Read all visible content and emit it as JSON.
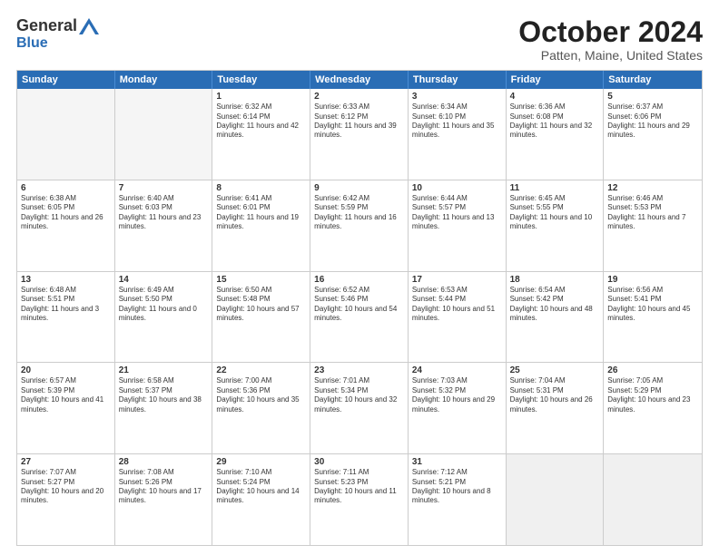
{
  "logo": {
    "general": "General",
    "blue": "Blue"
  },
  "title": "October 2024",
  "subtitle": "Patten, Maine, United States",
  "days": [
    "Sunday",
    "Monday",
    "Tuesday",
    "Wednesday",
    "Thursday",
    "Friday",
    "Saturday"
  ],
  "rows": [
    [
      {
        "day": "",
        "empty": true
      },
      {
        "day": "",
        "empty": true
      },
      {
        "day": "1",
        "sunrise": "Sunrise: 6:32 AM",
        "sunset": "Sunset: 6:14 PM",
        "daylight": "Daylight: 11 hours and 42 minutes."
      },
      {
        "day": "2",
        "sunrise": "Sunrise: 6:33 AM",
        "sunset": "Sunset: 6:12 PM",
        "daylight": "Daylight: 11 hours and 39 minutes."
      },
      {
        "day": "3",
        "sunrise": "Sunrise: 6:34 AM",
        "sunset": "Sunset: 6:10 PM",
        "daylight": "Daylight: 11 hours and 35 minutes."
      },
      {
        "day": "4",
        "sunrise": "Sunrise: 6:36 AM",
        "sunset": "Sunset: 6:08 PM",
        "daylight": "Daylight: 11 hours and 32 minutes."
      },
      {
        "day": "5",
        "sunrise": "Sunrise: 6:37 AM",
        "sunset": "Sunset: 6:06 PM",
        "daylight": "Daylight: 11 hours and 29 minutes."
      }
    ],
    [
      {
        "day": "6",
        "sunrise": "Sunrise: 6:38 AM",
        "sunset": "Sunset: 6:05 PM",
        "daylight": "Daylight: 11 hours and 26 minutes."
      },
      {
        "day": "7",
        "sunrise": "Sunrise: 6:40 AM",
        "sunset": "Sunset: 6:03 PM",
        "daylight": "Daylight: 11 hours and 23 minutes."
      },
      {
        "day": "8",
        "sunrise": "Sunrise: 6:41 AM",
        "sunset": "Sunset: 6:01 PM",
        "daylight": "Daylight: 11 hours and 19 minutes."
      },
      {
        "day": "9",
        "sunrise": "Sunrise: 6:42 AM",
        "sunset": "Sunset: 5:59 PM",
        "daylight": "Daylight: 11 hours and 16 minutes."
      },
      {
        "day": "10",
        "sunrise": "Sunrise: 6:44 AM",
        "sunset": "Sunset: 5:57 PM",
        "daylight": "Daylight: 11 hours and 13 minutes."
      },
      {
        "day": "11",
        "sunrise": "Sunrise: 6:45 AM",
        "sunset": "Sunset: 5:55 PM",
        "daylight": "Daylight: 11 hours and 10 minutes."
      },
      {
        "day": "12",
        "sunrise": "Sunrise: 6:46 AM",
        "sunset": "Sunset: 5:53 PM",
        "daylight": "Daylight: 11 hours and 7 minutes."
      }
    ],
    [
      {
        "day": "13",
        "sunrise": "Sunrise: 6:48 AM",
        "sunset": "Sunset: 5:51 PM",
        "daylight": "Daylight: 11 hours and 3 minutes."
      },
      {
        "day": "14",
        "sunrise": "Sunrise: 6:49 AM",
        "sunset": "Sunset: 5:50 PM",
        "daylight": "Daylight: 11 hours and 0 minutes."
      },
      {
        "day": "15",
        "sunrise": "Sunrise: 6:50 AM",
        "sunset": "Sunset: 5:48 PM",
        "daylight": "Daylight: 10 hours and 57 minutes."
      },
      {
        "day": "16",
        "sunrise": "Sunrise: 6:52 AM",
        "sunset": "Sunset: 5:46 PM",
        "daylight": "Daylight: 10 hours and 54 minutes."
      },
      {
        "day": "17",
        "sunrise": "Sunrise: 6:53 AM",
        "sunset": "Sunset: 5:44 PM",
        "daylight": "Daylight: 10 hours and 51 minutes."
      },
      {
        "day": "18",
        "sunrise": "Sunrise: 6:54 AM",
        "sunset": "Sunset: 5:42 PM",
        "daylight": "Daylight: 10 hours and 48 minutes."
      },
      {
        "day": "19",
        "sunrise": "Sunrise: 6:56 AM",
        "sunset": "Sunset: 5:41 PM",
        "daylight": "Daylight: 10 hours and 45 minutes."
      }
    ],
    [
      {
        "day": "20",
        "sunrise": "Sunrise: 6:57 AM",
        "sunset": "Sunset: 5:39 PM",
        "daylight": "Daylight: 10 hours and 41 minutes."
      },
      {
        "day": "21",
        "sunrise": "Sunrise: 6:58 AM",
        "sunset": "Sunset: 5:37 PM",
        "daylight": "Daylight: 10 hours and 38 minutes."
      },
      {
        "day": "22",
        "sunrise": "Sunrise: 7:00 AM",
        "sunset": "Sunset: 5:36 PM",
        "daylight": "Daylight: 10 hours and 35 minutes."
      },
      {
        "day": "23",
        "sunrise": "Sunrise: 7:01 AM",
        "sunset": "Sunset: 5:34 PM",
        "daylight": "Daylight: 10 hours and 32 minutes."
      },
      {
        "day": "24",
        "sunrise": "Sunrise: 7:03 AM",
        "sunset": "Sunset: 5:32 PM",
        "daylight": "Daylight: 10 hours and 29 minutes."
      },
      {
        "day": "25",
        "sunrise": "Sunrise: 7:04 AM",
        "sunset": "Sunset: 5:31 PM",
        "daylight": "Daylight: 10 hours and 26 minutes."
      },
      {
        "day": "26",
        "sunrise": "Sunrise: 7:05 AM",
        "sunset": "Sunset: 5:29 PM",
        "daylight": "Daylight: 10 hours and 23 minutes."
      }
    ],
    [
      {
        "day": "27",
        "sunrise": "Sunrise: 7:07 AM",
        "sunset": "Sunset: 5:27 PM",
        "daylight": "Daylight: 10 hours and 20 minutes."
      },
      {
        "day": "28",
        "sunrise": "Sunrise: 7:08 AM",
        "sunset": "Sunset: 5:26 PM",
        "daylight": "Daylight: 10 hours and 17 minutes."
      },
      {
        "day": "29",
        "sunrise": "Sunrise: 7:10 AM",
        "sunset": "Sunset: 5:24 PM",
        "daylight": "Daylight: 10 hours and 14 minutes."
      },
      {
        "day": "30",
        "sunrise": "Sunrise: 7:11 AM",
        "sunset": "Sunset: 5:23 PM",
        "daylight": "Daylight: 10 hours and 11 minutes."
      },
      {
        "day": "31",
        "sunrise": "Sunrise: 7:12 AM",
        "sunset": "Sunset: 5:21 PM",
        "daylight": "Daylight: 10 hours and 8 minutes."
      },
      {
        "day": "",
        "empty": true,
        "shaded": true
      },
      {
        "day": "",
        "empty": true,
        "shaded": true
      }
    ]
  ]
}
